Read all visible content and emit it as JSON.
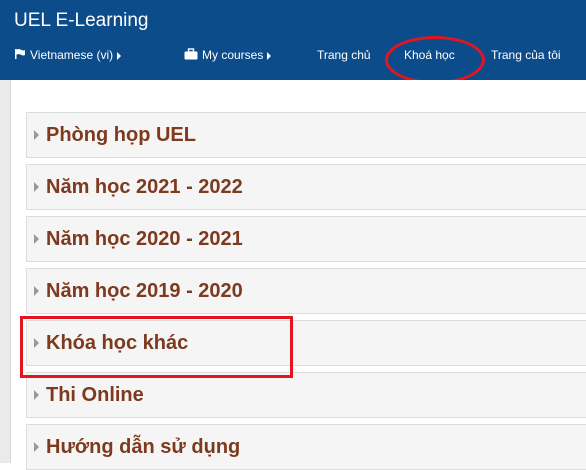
{
  "navbar": {
    "brand": "UEL E-Learning",
    "items": [
      {
        "label": "Vietnamese (vi)",
        "icon": "flag-icon",
        "has_submenu": true
      },
      {
        "label": "My courses",
        "icon": "briefcase-icon",
        "has_submenu": true
      },
      {
        "label": "Trang chủ",
        "icon": null,
        "has_submenu": false
      },
      {
        "label": "Khoá học",
        "icon": null,
        "has_submenu": false
      },
      {
        "label": "Trang của tôi",
        "icon": null,
        "has_submenu": false
      }
    ]
  },
  "categories": [
    {
      "label": "Phòng họp UEL"
    },
    {
      "label": "Năm học 2021 - 2022"
    },
    {
      "label": "Năm học 2020 - 2021"
    },
    {
      "label": "Năm học 2019 - 2020"
    },
    {
      "label": "Khóa học khác"
    },
    {
      "label": "Thi Online"
    },
    {
      "label": "Hướng dẫn sử dụng"
    }
  ],
  "colors": {
    "navbar_bg": "#0c4c8a",
    "category_text": "#7d3a1e",
    "annotation": "#e3161f"
  }
}
